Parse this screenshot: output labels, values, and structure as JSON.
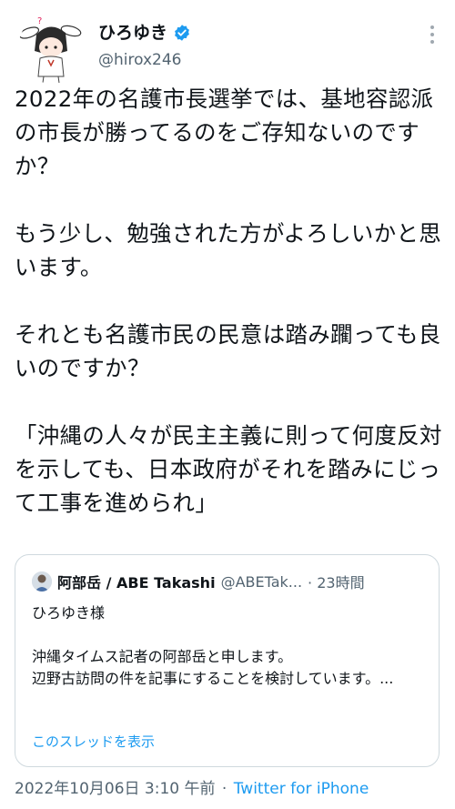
{
  "user": {
    "name": "ひろゆき",
    "handle": "@hirox246",
    "verified_color": "#1d9bf0"
  },
  "tweet": {
    "text": "2022年の名護市長選挙では、基地容認派の市長が勝ってるのをご存知ないのですか？\n\nもう少し、勉強された方がよろしいかと思います。\n\nそれとも名護市民の民意は踏み躙っても良いのですか？\n\n「沖縄の人々が民主主義に則って何度反対を示しても、日本政府がそれを踏みにじって工事を進められ」"
  },
  "quote": {
    "name": "阿部岳 / ABE Takashi",
    "handle": "@ABETak...",
    "time": "· 23時間",
    "text": "ひろゆき様\n\n沖縄タイムス記者の阿部岳と申します。\n辺野古訪問の件を記事にすることを検討しています。...",
    "show_thread": "このスレッドを表示"
  },
  "footer": {
    "timestamp": "2022年10月06日 3:10 午前",
    "separator": "·",
    "source": "Twitter for iPhone"
  },
  "colors": {
    "link": "#1d9bf0",
    "secondary": "#536471",
    "border": "#cfd9de"
  },
  "icons": [
    "avatar-illustration",
    "verified-badge-icon",
    "more-options-icon",
    "quote-avatar"
  ]
}
